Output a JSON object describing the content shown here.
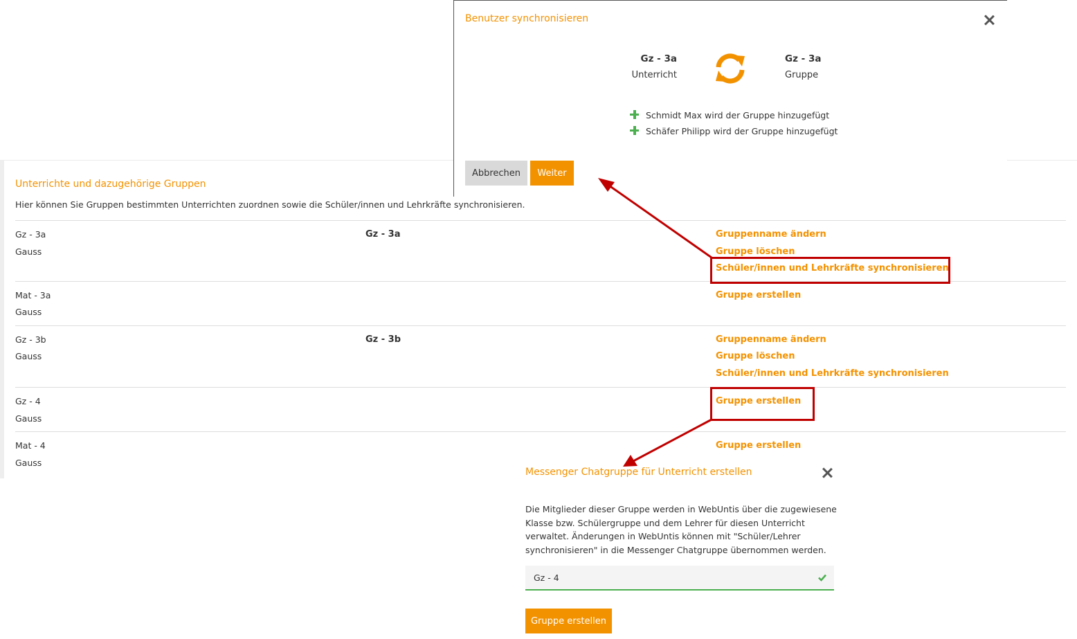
{
  "section": {
    "title": "Unterrichte und dazugehörige Gruppen",
    "description": "Hier können Sie Gruppen bestimmten Unterrichten zuordnen sowie die Schüler/innen und Lehrkräfte synchronisieren."
  },
  "rows": [
    {
      "lesson": "Gz - 3a",
      "teacher": "Gauss",
      "group": "Gz - 3a",
      "actions": [
        "Gruppenname ändern",
        "Gruppe löschen",
        "Schüler/innen und Lehrkräfte synchronisieren"
      ]
    },
    {
      "lesson": "Mat - 3a",
      "teacher": "Gauss",
      "group": "",
      "actions": [
        "Gruppe erstellen"
      ]
    },
    {
      "lesson": "Gz - 3b",
      "teacher": "Gauss",
      "group": "Gz - 3b",
      "actions": [
        "Gruppenname ändern",
        "Gruppe löschen",
        "Schüler/innen und Lehrkräfte synchronisieren"
      ]
    },
    {
      "lesson": "Gz - 4",
      "teacher": "Gauss",
      "group": "",
      "actions": [
        "Gruppe erstellen"
      ]
    },
    {
      "lesson": "Mat - 4",
      "teacher": "Gauss",
      "group": "",
      "actions": [
        "Gruppe erstellen"
      ]
    }
  ],
  "sync_modal": {
    "title": "Benutzer synchronisieren",
    "source_name": "Gz - 3a",
    "source_type": "Unterricht",
    "target_name": "Gz - 3a",
    "target_type": "Gruppe",
    "changes": [
      "Schmidt Max wird der Gruppe hinzugefügt",
      "Schäfer Philipp wird der Gruppe hinzugefügt"
    ],
    "cancel_label": "Abbrechen",
    "next_label": "Weiter"
  },
  "create_modal": {
    "title": "Messenger Chatgruppe für Unterricht erstellen",
    "description": "Die Mitglieder dieser Gruppe werden in WebUntis über die zugewiesene Klasse bzw. Schülergruppe und dem Lehrer für diesen Unterricht verwaltet. Änderungen in WebUntis können mit \"Schüler/Lehrer synchronisieren\" in die Messenger Chatgruppe übernommen werden.",
    "input_value": "Gz - 4",
    "submit_label": "Gruppe erstellen"
  },
  "colors": {
    "accent": "#f39200",
    "success": "#4caf50",
    "annotation": "#c00000"
  },
  "icons": {
    "sync": "sync-icon",
    "close": "close-icon",
    "add": "plus-icon",
    "valid": "check-icon"
  }
}
